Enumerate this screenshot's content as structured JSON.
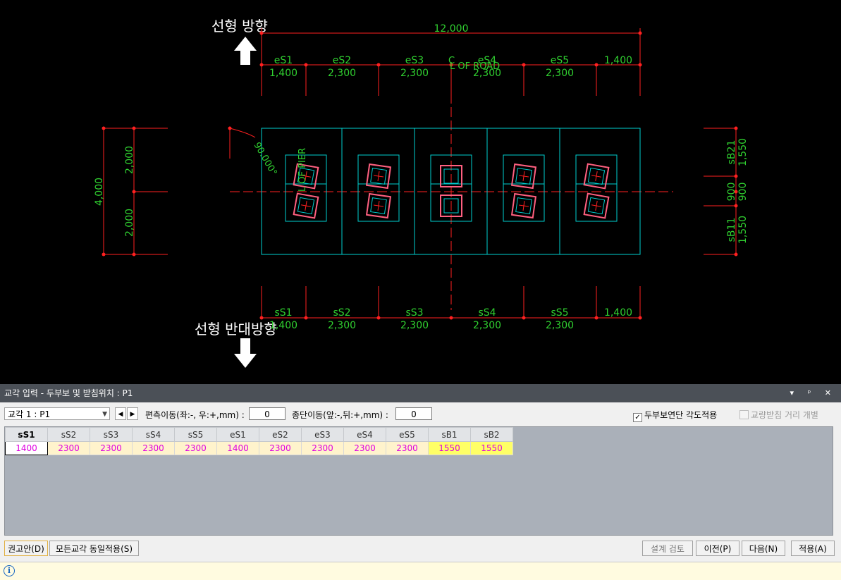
{
  "drawing": {
    "label_top": "선형 방향",
    "label_bottom": "선형 반대방향",
    "overall_width": "12,000",
    "road_label": "C\nL OF ROAD",
    "pier_label": "C\nL OF PIER",
    "angle_label": "90.000°",
    "top_segments": [
      "eS1",
      "eS2",
      "eS3",
      "eS4",
      "eS5"
    ],
    "top_values": [
      "1,400",
      "2,300",
      "2,300",
      "2,300",
      "2,300",
      "1,400"
    ],
    "bottom_segments": [
      "sS1",
      "sS2",
      "sS3",
      "sS4",
      "sS5"
    ],
    "bottom_values": [
      "1,400",
      "2,300",
      "2,300",
      "2,300",
      "2,300",
      "1,400"
    ],
    "left_total": "4,000",
    "left_values": [
      "2,000",
      "2,000"
    ],
    "right_labels": [
      "sB21",
      "sB11"
    ],
    "right_values": [
      "1,550",
      "900",
      "900",
      "1,550"
    ]
  },
  "panel": {
    "title": "교각 입력 - 두부보 및 받침위치 : P1",
    "title_buttons": "▾ ᵖ ✕",
    "pier_select": "교각 1 : P1",
    "transverse_label": "편측이동(좌:-, 우:+,mm) :",
    "transverse_value": "0",
    "longitudinal_label": "종단이동(앞:-,뒤:+,mm) :",
    "longitudinal_value": "0",
    "check_angle": "두부보연단 각도적용",
    "check_angle_mark": "✓",
    "check_distance": "교량받침 거리 개별"
  },
  "grid": {
    "headers": [
      "sS1",
      "sS2",
      "sS3",
      "sS4",
      "sS5",
      "eS1",
      "eS2",
      "eS3",
      "eS4",
      "eS5",
      "sB1",
      "sB2"
    ],
    "values": [
      "1400",
      "2300",
      "2300",
      "2300",
      "2300",
      "1400",
      "2300",
      "2300",
      "2300",
      "2300",
      "1550",
      "1550"
    ]
  },
  "buttons": {
    "recommend": "권고안(D)",
    "apply_all": "모든교각 동일적용(S)",
    "design_check": "설계 검토",
    "prev": "이전(P)",
    "next": "다음(N)",
    "apply": "적용(A)"
  },
  "colors": {
    "dim": "#ff2020",
    "text": "#30d030",
    "outline": "#00d0d0",
    "canvas": "#000000"
  }
}
